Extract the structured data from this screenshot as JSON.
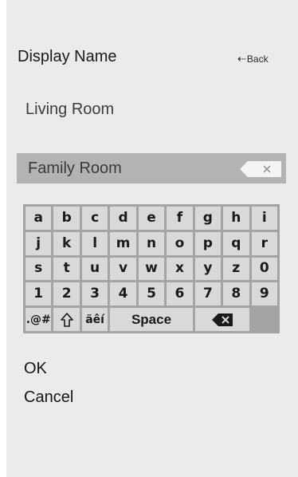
{
  "header": {
    "title": "Display Name",
    "back_label": "Back",
    "back_icon": "back-arrow-icon"
  },
  "options": [
    {
      "label": "Living Room"
    }
  ],
  "input": {
    "value": "Family Room",
    "clear_icon": "clear-icon"
  },
  "keyboard": {
    "rows": [
      [
        "a",
        "b",
        "c",
        "d",
        "e",
        "f",
        "g",
        "h",
        "i"
      ],
      [
        "j",
        "k",
        "l",
        "m",
        "n",
        "o",
        "p",
        "q",
        "r"
      ],
      [
        "s",
        "t",
        "u",
        "v",
        "w",
        "x",
        "y",
        "z",
        "0"
      ],
      [
        "1",
        "2",
        "3",
        "4",
        "5",
        "6",
        "7",
        "8",
        "9"
      ]
    ],
    "symbols_label": ".@#",
    "shift_icon": "shift-icon",
    "accents_label": "äêí",
    "space_label": "Space",
    "backspace_icon": "backspace-icon"
  },
  "actions": {
    "ok_label": "OK",
    "cancel_label": "Cancel"
  },
  "colors": {
    "panel_bg": "#ebebeb",
    "input_bg": "#b3b3b3",
    "keyboard_bg": "#a4a4a4",
    "key_bg": "#d9d9d9"
  }
}
